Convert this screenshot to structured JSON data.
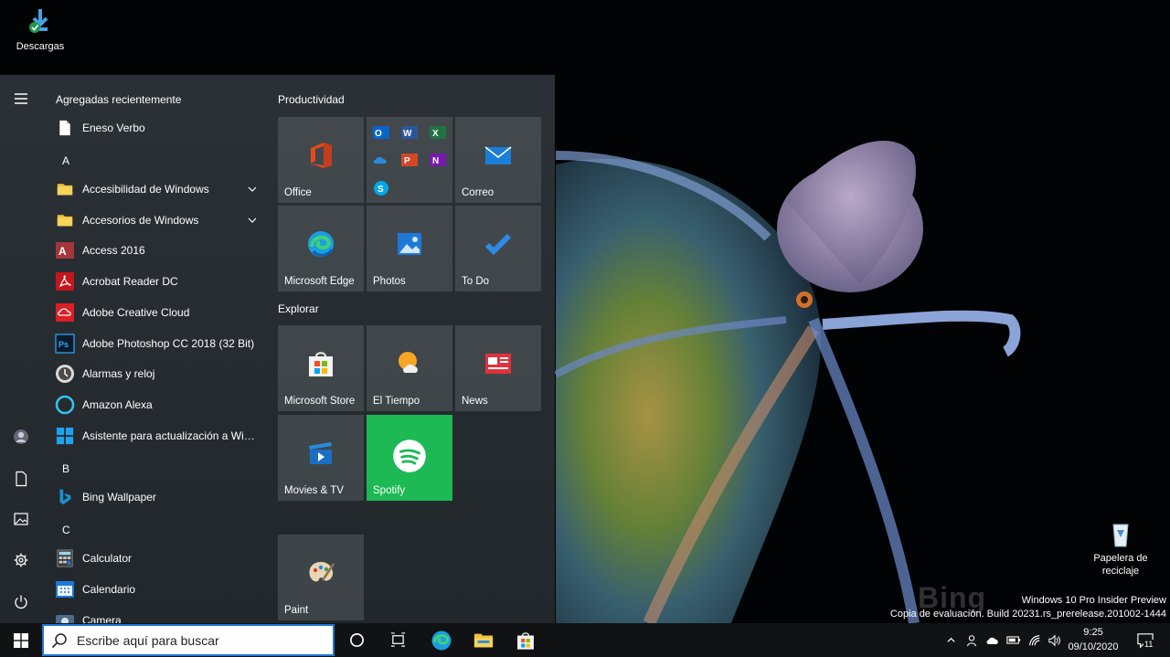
{
  "desktop": {
    "icons": {
      "downloads": "Descargas",
      "recycle_line1": "Papelera de",
      "recycle_line2": "reciclaje"
    },
    "bing_mark": "Bing",
    "watermark_line1": "Windows 10 Pro Insider Preview",
    "watermark_line2": "Copia de evaluación. Build 20231.rs_prerelease.201002-1444"
  },
  "start_menu": {
    "recent_header": "Agregadas recientemente",
    "apps": {
      "eneso": "Eneso Verbo",
      "letter_a": "A",
      "accesibilidad": "Accesibilidad de Windows",
      "accesorios": "Accesorios de Windows",
      "access": "Access 2016",
      "acrobat": "Acrobat Reader DC",
      "adobe_cc": "Adobe Creative Cloud",
      "photoshop": "Adobe Photoshop CC 2018 (32 Bit)",
      "alarmas": "Alarmas y reloj",
      "alexa": "Amazon Alexa",
      "asistente": "Asistente para actualización a Windo...",
      "letter_b": "B",
      "bing_wallpaper": "Bing Wallpaper",
      "letter_c": "C",
      "calculator": "Calculator",
      "calendario": "Calendario",
      "camera": "Camera"
    },
    "groups": {
      "productividad": "Productividad",
      "explorar": "Explorar"
    },
    "tiles": {
      "office": "Office",
      "correo": "Correo",
      "edge": "Microsoft Edge",
      "photos": "Photos",
      "todo": "To Do",
      "store": "Microsoft Store",
      "tiempo": "El Tiempo",
      "news": "News",
      "movies": "Movies & TV",
      "spotify": "Spotify",
      "paint": "Paint"
    }
  },
  "taskbar": {
    "search_placeholder": "Escribe aquí para buscar",
    "time": "9:25",
    "date": "09/10/2020",
    "notification_count": "11"
  },
  "colors": {
    "accent_blue": "#1e78d7",
    "spotify_green": "#1db954"
  }
}
